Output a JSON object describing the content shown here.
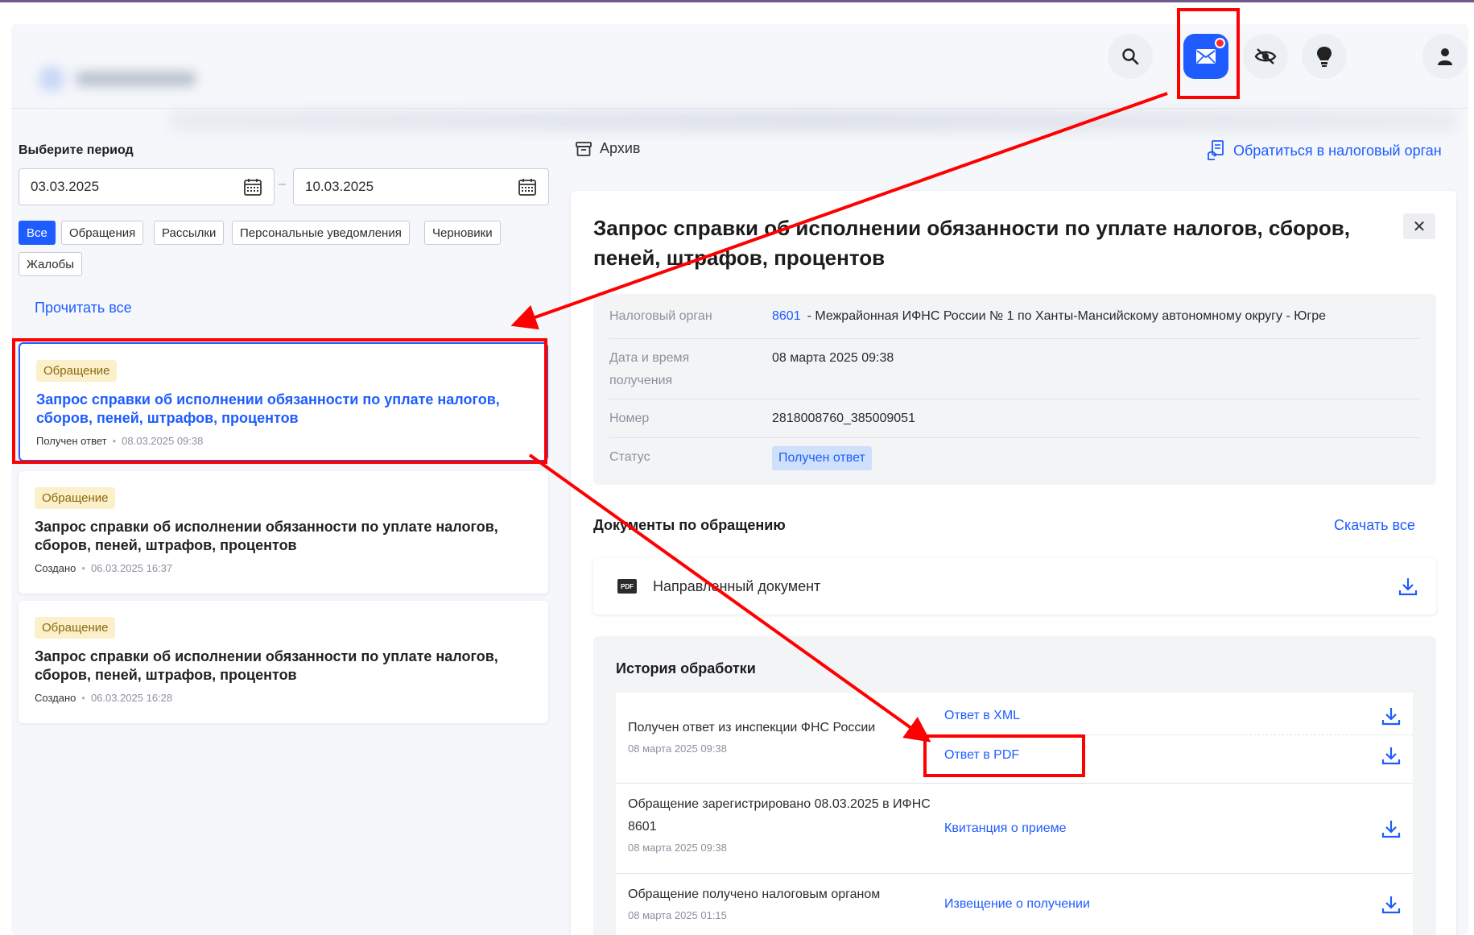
{
  "header": {
    "search_icon": "search-icon",
    "mail_icon": "mail-icon",
    "eye_icon": "eye-off-icon",
    "bulb_icon": "lightbulb-icon",
    "user_icon": "user-icon"
  },
  "filters": {
    "period_label": "Выберите период",
    "date_from": "03.03.2025",
    "date_to": "10.03.2025",
    "chips": [
      "Все",
      "Обращения",
      "Рассылки",
      "Персональные уведомления",
      "Черновики",
      "Жалобы"
    ],
    "read_all": "Прочитать все"
  },
  "messages": [
    {
      "badge": "Обращение",
      "title": "Запрос справки об исполнении обязанности по уплате налогов, сборов, пеней, штрафов, процентов",
      "status": "Получен ответ",
      "time": "08.03.2025 09:38"
    },
    {
      "badge": "Обращение",
      "title": "Запрос справки об исполнении обязанности по уплате налогов, сборов, пеней, штрафов, процентов",
      "status": "Создано",
      "time": "06.03.2025 16:37"
    },
    {
      "badge": "Обращение",
      "title": "Запрос справки об исполнении обязанности по уплате налогов, сборов, пеней, штрафов, процентов",
      "status": "Создано",
      "time": "06.03.2025 16:28"
    }
  ],
  "toolbar": {
    "archive": "Архив",
    "contact": "Обратиться в налоговый орган"
  },
  "detail": {
    "title": "Запрос справки об исполнении обязанности по уплате налогов, сборов, пеней, штрафов, процентов",
    "close": "✕",
    "info": {
      "tax_authority_label": "Налоговый орган",
      "tax_authority_code": "8601",
      "tax_authority_name": "- Межрайонная ИФНС России № 1 по Ханты-Мансийскому автономному округу - Югре",
      "date_label": "Дата и время получения",
      "date_value": "08 марта 2025 09:38",
      "number_label": "Номер",
      "number_value": "2818008760_385009051",
      "status_label": "Статус",
      "status_value": "Получен ответ"
    },
    "documents": {
      "heading": "Документы по обращению",
      "download_all": "Скачать все",
      "pdf_label": "PDF",
      "items": [
        "Направленный документ"
      ]
    },
    "history": {
      "heading": "История обработки",
      "rows": [
        {
          "text": "Получен ответ из инспекции ФНС России",
          "time": "08 марта 2025 09:38",
          "links": [
            "Ответ в XML",
            "Ответ в PDF"
          ]
        },
        {
          "text": "Обращение зарегистрировано 08.03.2025 в ИФНС 8601",
          "time": "08 марта 2025 09:38",
          "links": [
            "Квитанция о приеме"
          ]
        },
        {
          "text": "Обращение получено налоговым органом",
          "time": "08 марта 2025 01:15",
          "links": [
            "Извещение о получении"
          ]
        }
      ]
    }
  },
  "colors": {
    "accent": "#1e5cff",
    "annotation": "#ff0000",
    "badge_bg": "#fbf0c9"
  }
}
